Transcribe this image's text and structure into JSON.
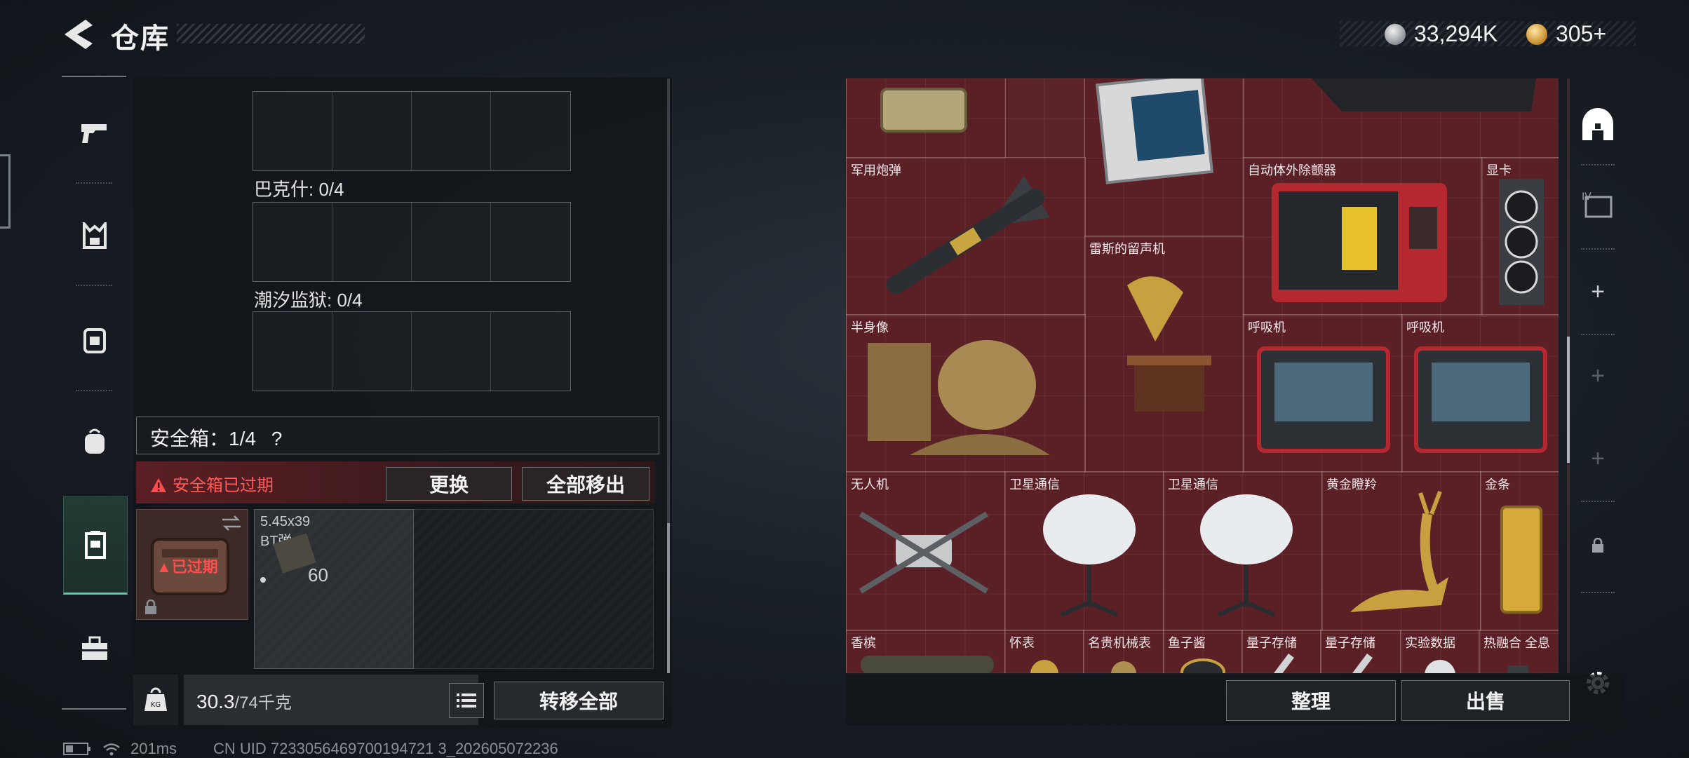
{
  "header": {
    "title": "仓库"
  },
  "currency": [
    {
      "icon": "silver-coin-icon",
      "value": "33,294K"
    },
    {
      "icon": "gold-coin-icon",
      "value": "305+"
    }
  ],
  "left_rail": [
    {
      "icon": "pistol-icon",
      "selected": false
    },
    {
      "icon": "armor-vest-icon",
      "selected": false
    },
    {
      "icon": "chest-rig-icon",
      "selected": false
    },
    {
      "icon": "backpack-icon",
      "selected": false
    },
    {
      "icon": "secure-case-icon",
      "selected": true
    },
    {
      "icon": "toolbox-icon",
      "selected": false
    }
  ],
  "keys": {
    "groups": [
      {
        "label": "巴克什: 0/4"
      },
      {
        "label": "潮汐监狱: 0/4"
      }
    ]
  },
  "secure_case": {
    "label": "安全箱：1/4",
    "help": "?",
    "expired_warning": "安全箱已过期",
    "replace_label": "更换",
    "remove_all_label": "全部移出",
    "case_badge": "已过期",
    "ammo": {
      "name_line1": "5.45x39",
      "name_line2": "BT弹",
      "count": "60"
    }
  },
  "bottom_left": {
    "weight_current": "30.3",
    "weight_total": "/74千克",
    "transfer_all_label": "转移全部"
  },
  "status_bar": {
    "ping": "201ms",
    "uid": "CN UID 7233056469700194721 3_202605072236"
  },
  "stash_items": [
    {
      "name": "军用炮弹"
    },
    {
      "name": "自动体外除颤器"
    },
    {
      "name": "显卡"
    },
    {
      "name": "雷斯的留声机"
    },
    {
      "name": "半身像"
    },
    {
      "name": "呼吸机"
    },
    {
      "name": "呼吸机"
    },
    {
      "name": "无人机"
    },
    {
      "name": "卫星通信"
    },
    {
      "name": "卫星通信"
    },
    {
      "name": "黄金瞪羚"
    },
    {
      "name": "金条"
    },
    {
      "name": "香槟"
    },
    {
      "name": "怀表"
    },
    {
      "name": "名贵机械表"
    },
    {
      "name": "鱼子酱"
    },
    {
      "name": "量子存储"
    },
    {
      "name": "量子存储"
    },
    {
      "name": "实验数据"
    },
    {
      "name": "热融合 全息"
    }
  ],
  "right_actions": {
    "sort_label": "整理",
    "sell_label": "出售"
  },
  "colors": {
    "accent_green": "#4fd1a5",
    "warning_red": "#ff5a5a",
    "stash_bg": "#5b2227"
  }
}
